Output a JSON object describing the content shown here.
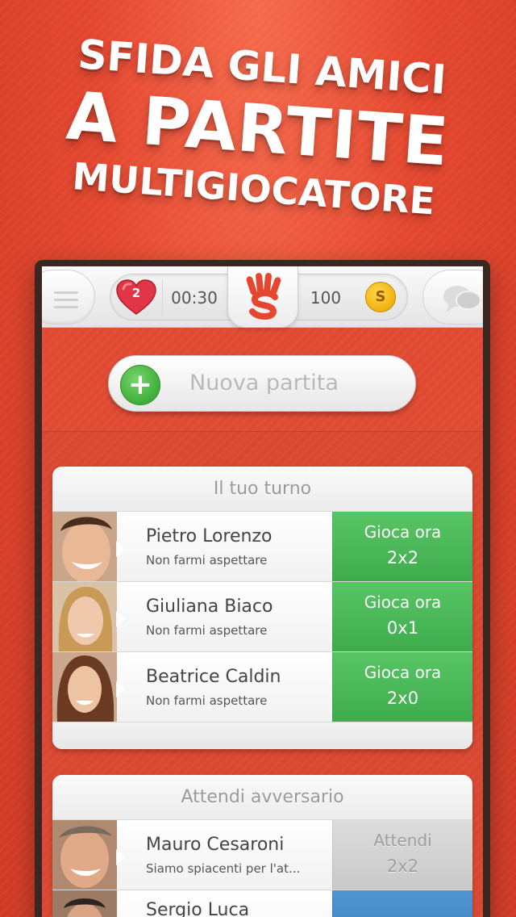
{
  "headline": {
    "line1": "SFIDA GLI AMICI",
    "line2": "A PARTITE",
    "line3": "MULTIGIOCATORE"
  },
  "topbar": {
    "lives": "2",
    "timer": "00:30",
    "coins": "100",
    "coin_glyph": "S"
  },
  "new_game": {
    "plus": "+",
    "label": "Nuova partita"
  },
  "your_turn": {
    "title": "Il tuo turno",
    "rows": [
      {
        "name": "Pietro Lorenzo",
        "status": "Non farmi aspettare",
        "action": "Gioca ora",
        "score": "2x2"
      },
      {
        "name": "Giuliana Biaco",
        "status": "Non farmi aspettare",
        "action": "Gioca ora",
        "score": "0x1"
      },
      {
        "name": "Beatrice Caldin",
        "status": "Non farmi aspettare",
        "action": "Gioca ora",
        "score": "2x0"
      }
    ]
  },
  "waiting": {
    "title": "Attendi avversario",
    "rows": [
      {
        "name": "Mauro Cesaroni",
        "status": "Siamo spiacenti per l'at...",
        "action": "Attendi",
        "score": "2x2"
      },
      {
        "name": "Sergio Luca",
        "status": "",
        "action": "",
        "score": ""
      }
    ]
  },
  "colors": {
    "background": "#e04a32",
    "play_green": "#4cba5a",
    "wait_gray": "#d2d2d2",
    "accent_blue": "#3f86c5"
  },
  "icons": [
    "menu-icon",
    "heart-icon",
    "hand-logo-icon",
    "coin-icon",
    "chat-bubbles-icon",
    "plus-icon"
  ]
}
